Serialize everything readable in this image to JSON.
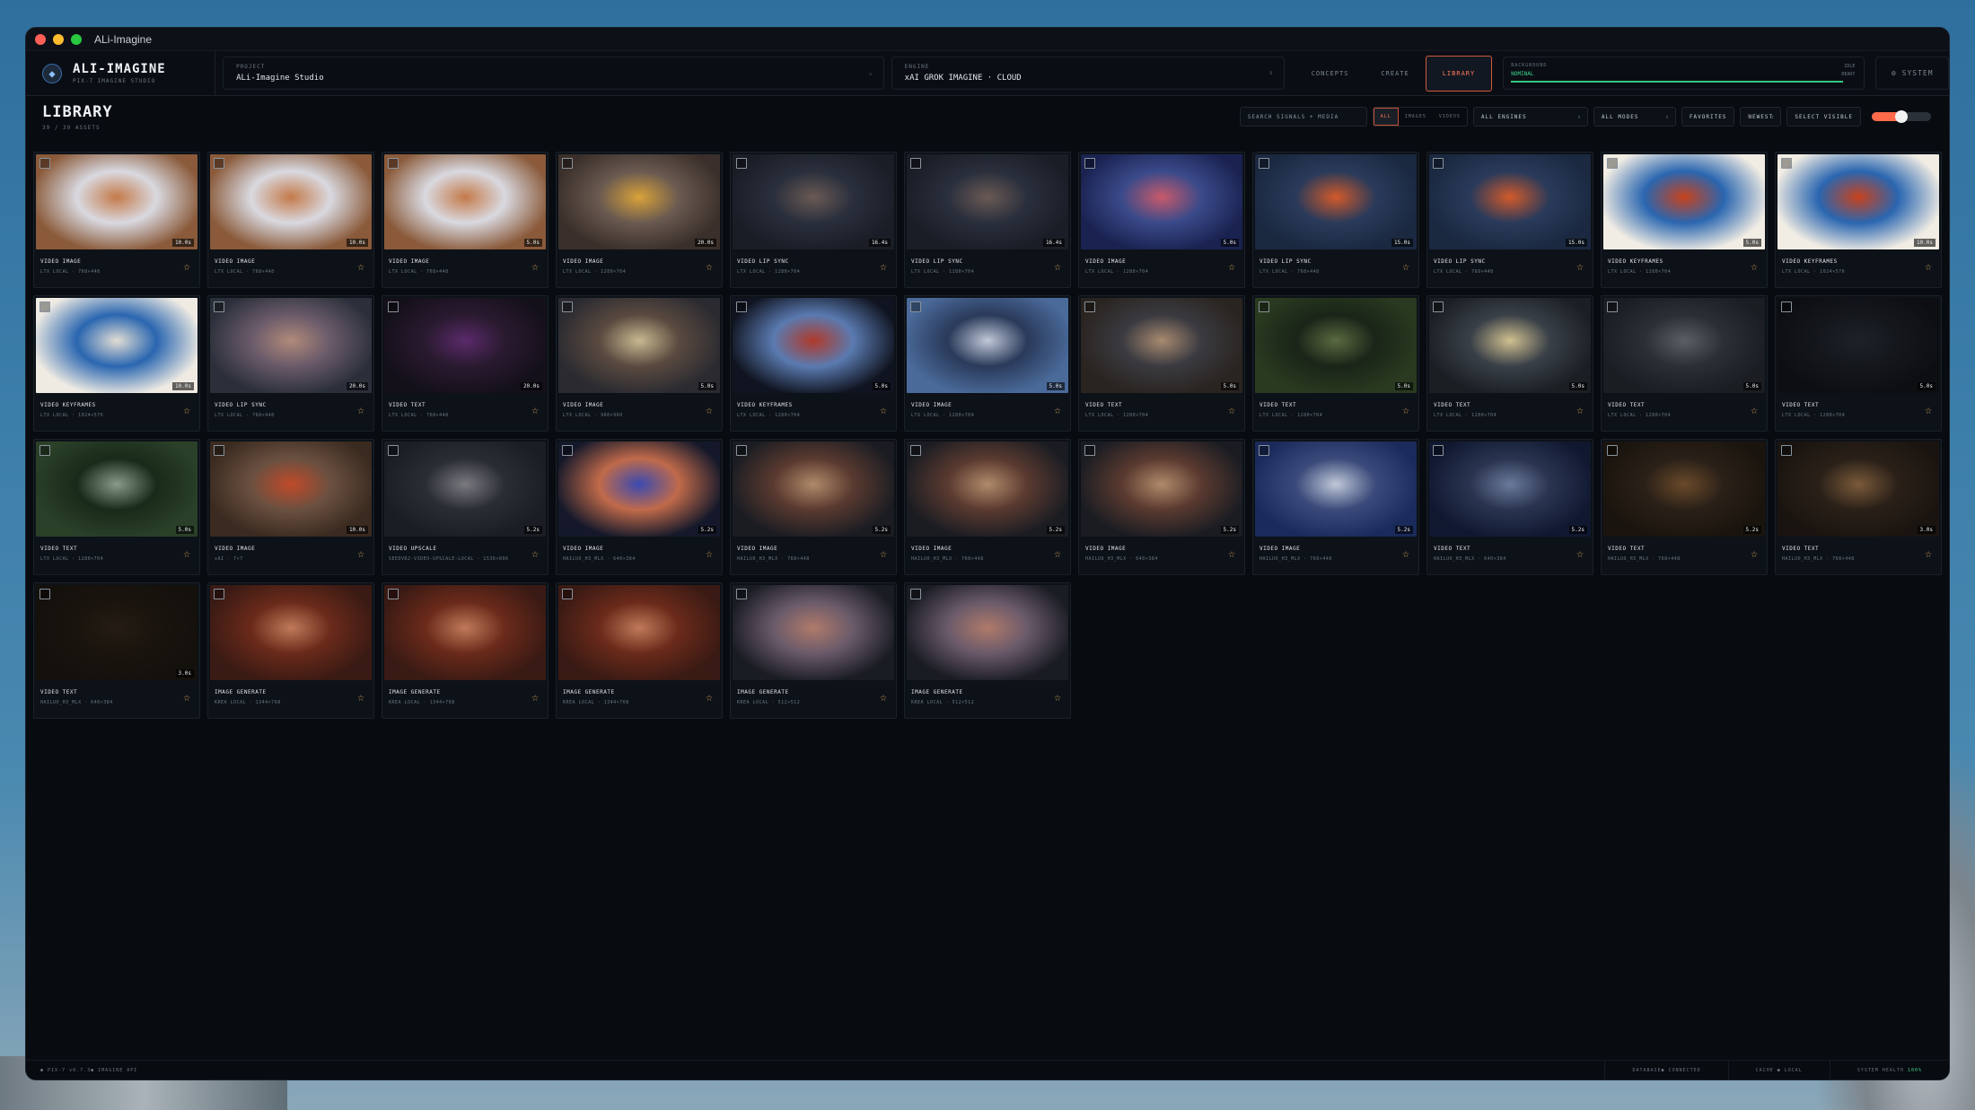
{
  "window": {
    "title": "ALi-Imagine"
  },
  "brand": {
    "title": "ALI-IMAGINE",
    "subtitle": "PIX-7 IMAGINE STUDIO"
  },
  "project": {
    "label": "PROJECT",
    "value": "ALi-Imagine Studio"
  },
  "engine": {
    "label": "ENGINE",
    "value": "xAI GROK IMAGINE · CLOUD"
  },
  "tabs": [
    {
      "label": "CONCEPTS",
      "active": false
    },
    {
      "label": "CREATE",
      "active": false
    },
    {
      "label": "LIBRARY",
      "active": true
    }
  ],
  "background": {
    "label": "BACKGROUND",
    "status": "NOMINAL",
    "right_top": "IDLE",
    "right_bottom": "READY"
  },
  "system": {
    "label": "SYSTEM"
  },
  "library": {
    "title": "LIBRARY",
    "count": "39 / 39 ASSETS",
    "search_placeholder": "SEARCH SIGNALS + MEDIA",
    "filters": [
      "ALL",
      "IMAGES",
      "VIDEOS"
    ],
    "engines": "ALL ENGINES",
    "modes": "ALL MODES",
    "favorites": "FAVORITES",
    "sort": "NEWEST",
    "select_visible": "SELECT VISIBLE"
  },
  "cards": [
    {
      "title": "VIDEO IMAGE",
      "sub": "LTX LOCAL · 768×448",
      "dur": "10.0s",
      "palette": [
        "#8a5a3a",
        "#c47a4a",
        "#d9d9e0"
      ]
    },
    {
      "title": "VIDEO IMAGE",
      "sub": "LTX LOCAL · 768×448",
      "dur": "10.0s",
      "palette": [
        "#8a5a3a",
        "#c47a4a",
        "#d9d9e0"
      ]
    },
    {
      "title": "VIDEO IMAGE",
      "sub": "LTX LOCAL · 768×448",
      "dur": "5.0s",
      "palette": [
        "#8a5a3a",
        "#c47a4a",
        "#d9d9e0"
      ]
    },
    {
      "title": "VIDEO IMAGE",
      "sub": "LTX LOCAL · 1280×704",
      "dur": "20.0s",
      "palette": [
        "#3a2f2a",
        "#d9a23a",
        "#6a5a50"
      ]
    },
    {
      "title": "VIDEO LIP SYNC",
      "sub": "LTX LOCAL · 1280×704",
      "dur": "16.4s",
      "palette": [
        "#1a1d26",
        "#6a5a55",
        "#2a2f3c"
      ]
    },
    {
      "title": "VIDEO LIP SYNC",
      "sub": "LTX LOCAL · 1280×704",
      "dur": "16.4s",
      "palette": [
        "#1a1d26",
        "#6a5a55",
        "#2a2f3c"
      ]
    },
    {
      "title": "VIDEO IMAGE",
      "sub": "LTX LOCAL · 1280×704",
      "dur": "5.0s",
      "palette": [
        "#1a2250",
        "#c85a6a",
        "#3a4a8a"
      ]
    },
    {
      "title": "VIDEO LIP SYNC",
      "sub": "LTX LOCAL · 768×448",
      "dur": "15.0s",
      "palette": [
        "#1a2840",
        "#d25a2a",
        "#2a3a5a"
      ]
    },
    {
      "title": "VIDEO LIP SYNC",
      "sub": "LTX LOCAL · 768×448",
      "dur": "15.0s",
      "palette": [
        "#1a2840",
        "#d25a2a",
        "#2a3a5a"
      ]
    },
    {
      "title": "VIDEO KEYFRAMES",
      "sub": "LTX LOCAL · 1280×704",
      "dur": "5.0s",
      "palette": [
        "#f2ede4",
        "#c8421c",
        "#2a66b0"
      ]
    },
    {
      "title": "VIDEO KEYFRAMES",
      "sub": "LTX LOCAL · 1024×576",
      "dur": "10.0s",
      "palette": [
        "#f2ede4",
        "#c8421c",
        "#2a66b0"
      ]
    },
    {
      "title": "VIDEO KEYFRAMES",
      "sub": "LTX LOCAL · 1024×576",
      "dur": "10.0s",
      "palette": [
        "#efebe3",
        "#e2ddd4",
        "#2a66b0"
      ]
    },
    {
      "title": "VIDEO LIP SYNC",
      "sub": "LTX LOCAL · 768×448",
      "dur": "20.0s",
      "palette": [
        "#2a2f3a",
        "#b08a7a",
        "#6a5a6a"
      ]
    },
    {
      "title": "VIDEO TEXT",
      "sub": "LTX LOCAL · 768×448",
      "dur": "20.0s",
      "palette": [
        "#14101a",
        "#5a2a6a",
        "#2a1a30"
      ]
    },
    {
      "title": "VIDEO IMAGE",
      "sub": "LTX LOCAL · 960×960",
      "dur": "5.0s",
      "palette": [
        "#2a2a30",
        "#c8b890",
        "#5a4a40"
      ]
    },
    {
      "title": "VIDEO KEYFRAMES",
      "sub": "LTX LOCAL · 1280×704",
      "dur": "5.0s",
      "palette": [
        "#101420",
        "#b03a2a",
        "#5a7ab0"
      ]
    },
    {
      "title": "VIDEO IMAGE",
      "sub": "LTX LOCAL · 1280×704",
      "dur": "5.0s",
      "palette": [
        "#4a6a9a",
        "#c0c8d8",
        "#2a3a5a"
      ]
    },
    {
      "title": "VIDEO TEXT",
      "sub": "LTX LOCAL · 1280×704",
      "dur": "5.0s",
      "palette": [
        "#2a2420",
        "#a88a70",
        "#3a3a40"
      ]
    },
    {
      "title": "VIDEO TEXT",
      "sub": "LTX LOCAL · 1280×704",
      "dur": "5.0s",
      "palette": [
        "#2a3a20",
        "#5a6a40",
        "#1a2418"
      ]
    },
    {
      "title": "VIDEO TEXT",
      "sub": "LTX LOCAL · 1280×704",
      "dur": "5.0s",
      "palette": [
        "#1a1f24",
        "#d0c090",
        "#3a4048"
      ]
    },
    {
      "title": "VIDEO TEXT",
      "sub": "LTX LOCAL · 1280×704",
      "dur": "5.0s",
      "palette": [
        "#1a1d22",
        "#5a5f66",
        "#2a2f36"
      ]
    },
    {
      "title": "VIDEO TEXT",
      "sub": "LTX LOCAL · 1280×704",
      "dur": "5.0s",
      "palette": [
        "#0c0e12",
        "#1e2228",
        "#14171c"
      ]
    },
    {
      "title": "VIDEO TEXT",
      "sub": "LTX LOCAL · 1280×704",
      "dur": "5.0s",
      "palette": [
        "#2a4028",
        "#8a9a8a",
        "#1a2a1a"
      ]
    },
    {
      "title": "VIDEO IMAGE",
      "sub": "xAI · 7×7",
      "dur": "10.0s",
      "palette": [
        "#3a2a20",
        "#c04a2a",
        "#6a5040"
      ]
    },
    {
      "title": "VIDEO UPSCALE",
      "sub": "SEEDVR2-VIDEO-UPSCALE-LOCAL · 1536×896",
      "dur": "5.2s",
      "palette": [
        "#1a1d24",
        "#7a7a80",
        "#2a2d34"
      ]
    },
    {
      "title": "VIDEO IMAGE",
      "sub": "HAILUO_H3_MLX · 640×384",
      "dur": "5.2s",
      "palette": [
        "#14182a",
        "#3a4ab0",
        "#c06a4a"
      ]
    },
    {
      "title": "VIDEO IMAGE",
      "sub": "HAILUO_H3_MLX · 768×448",
      "dur": "5.2s",
      "palette": [
        "#1a1c22",
        "#b08a6a",
        "#5a3a30"
      ]
    },
    {
      "title": "VIDEO IMAGE",
      "sub": "HAILUO_H3_MLX · 768×448",
      "dur": "5.2s",
      "palette": [
        "#1a1c22",
        "#b08a6a",
        "#5a3a30"
      ]
    },
    {
      "title": "VIDEO IMAGE",
      "sub": "HAILUO_H3_MLX · 640×384",
      "dur": "5.2s",
      "palette": [
        "#1a1c22",
        "#b08a6a",
        "#5a3a30"
      ]
    },
    {
      "title": "VIDEO IMAGE",
      "sub": "HAILUO_H3_MLX · 768×448",
      "dur": "5.2s",
      "palette": [
        "#1a2a5a",
        "#c0c8d8",
        "#3a4a7a"
      ]
    },
    {
      "title": "VIDEO TEXT",
      "sub": "HAILUO_H3_MLX · 640×384",
      "dur": "5.2s",
      "palette": [
        "#101830",
        "#6a7a9a",
        "#2a3450"
      ]
    },
    {
      "title": "VIDEO TEXT",
      "sub": "HAILUO_H3_MLX · 768×448",
      "dur": "5.2s",
      "palette": [
        "#1a140e",
        "#6a4a2a",
        "#2a2018"
      ]
    },
    {
      "title": "VIDEO TEXT",
      "sub": "HAILUO_H3_MLX · 768×448",
      "dur": "3.0s",
      "palette": [
        "#1a1410",
        "#7a5a3a",
        "#2a2018"
      ]
    },
    {
      "title": "VIDEO TEXT",
      "sub": "HAILUO_H3_MLX · 640×384",
      "dur": "3.0s",
      "palette": [
        "#14100c",
        "#241c14",
        "#1a140e"
      ]
    },
    {
      "title": "IMAGE GENERATE",
      "sub": "KREA LOCAL · 1344×768",
      "dur": "",
      "palette": [
        "#3a1a14",
        "#c07a5a",
        "#6a2a1a"
      ]
    },
    {
      "title": "IMAGE GENERATE",
      "sub": "KREA LOCAL · 1344×768",
      "dur": "",
      "palette": [
        "#3a1a14",
        "#c07a5a",
        "#6a2a1a"
      ]
    },
    {
      "title": "IMAGE GENERATE",
      "sub": "KREA LOCAL · 1344×768",
      "dur": "",
      "palette": [
        "#3a1a14",
        "#c07a5a",
        "#6a2a1a"
      ]
    },
    {
      "title": "IMAGE GENERATE",
      "sub": "KREA LOCAL · 512×512",
      "dur": "",
      "palette": [
        "#1a1c24",
        "#b07a6a",
        "#6a5a6a"
      ]
    },
    {
      "title": "IMAGE GENERATE",
      "sub": "KREA LOCAL · 512×512",
      "dur": "",
      "palette": [
        "#1a1c24",
        "#b07a6a",
        "#6a5a6a"
      ]
    }
  ],
  "statusbar": {
    "left": "● PIX-7 v0.7.3● IMAGINE API",
    "database": "DATABASE● CONNECTED",
    "cache": "CACHE ● LOCAL",
    "health_label": "SYSTEM HEALTH",
    "health_value": "100%"
  }
}
